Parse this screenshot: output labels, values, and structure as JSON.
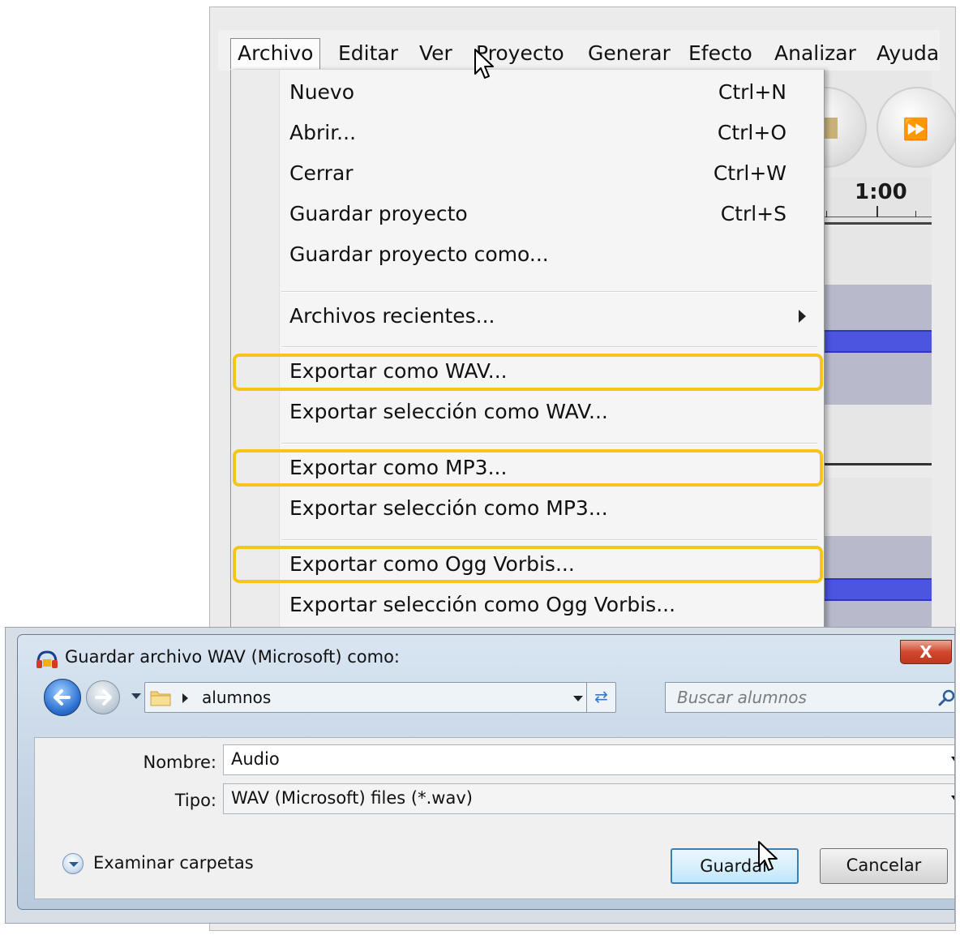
{
  "menubar": {
    "items": [
      "Archivo",
      "Editar",
      "Ver",
      "Proyecto",
      "Generar",
      "Efecto",
      "Analizar",
      "Ayuda"
    ]
  },
  "background": {
    "ruler_label": "1:00"
  },
  "file_menu": {
    "items": [
      {
        "label": "Nuevo",
        "shortcut": "Ctrl+N"
      },
      {
        "label": "Abrir...",
        "shortcut": "Ctrl+O"
      },
      {
        "label": "Cerrar",
        "shortcut": "Ctrl+W"
      },
      {
        "label": "Guardar proyecto",
        "shortcut": "Ctrl+S"
      },
      {
        "label": "Guardar proyecto como...",
        "shortcut": ""
      },
      {
        "label": "Archivos recientes...",
        "shortcut": ""
      },
      {
        "label": "Exportar como WAV...",
        "shortcut": ""
      },
      {
        "label": "Exportar selección como WAV...",
        "shortcut": ""
      },
      {
        "label": "Exportar como MP3...",
        "shortcut": ""
      },
      {
        "label": "Exportar selección como MP3...",
        "shortcut": ""
      },
      {
        "label": "Exportar como Ogg Vorbis...",
        "shortcut": ""
      },
      {
        "label": "Exportar selección como Ogg Vorbis...",
        "shortcut": ""
      }
    ],
    "highlight_color": "#f5c518"
  },
  "save_dialog": {
    "title": "Guardar archivo WAV (Microsoft) como:",
    "close_label": "X",
    "path": "alumnos",
    "search_placeholder": "Buscar alumnos",
    "name_label": "Nombre:",
    "name_value": "Audio",
    "type_label": "Tipo:",
    "type_value": "WAV (Microsoft) files (*.wav)",
    "browse_label": "Examinar carpetas",
    "save_label": "Guardar",
    "cancel_label": "Cancelar"
  }
}
